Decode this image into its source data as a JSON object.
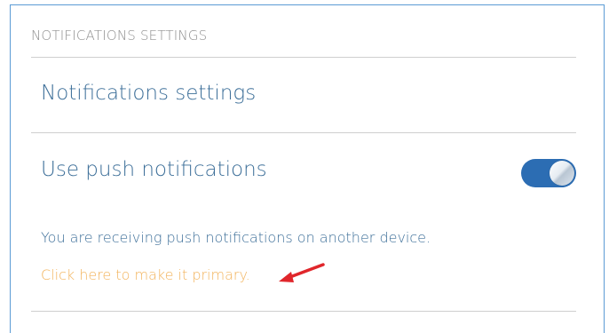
{
  "section": {
    "header": "NOTIFICATIONS SETTINGS"
  },
  "main": {
    "title": "Notifications settings",
    "push": {
      "label": "Use push notifications",
      "enabled": true,
      "toggle_color": "#2c6db3"
    },
    "info_text": "You are receiving push notifications on another device.",
    "primary_link": "Click here to make it primary."
  },
  "annotation": {
    "arrow_color": "#e0262b"
  },
  "colors": {
    "frame_border": "#5b9bd5",
    "text_blue": "#3d6f99",
    "link_orange": "#f2b35b",
    "header_gray": "#8f8f8f"
  }
}
